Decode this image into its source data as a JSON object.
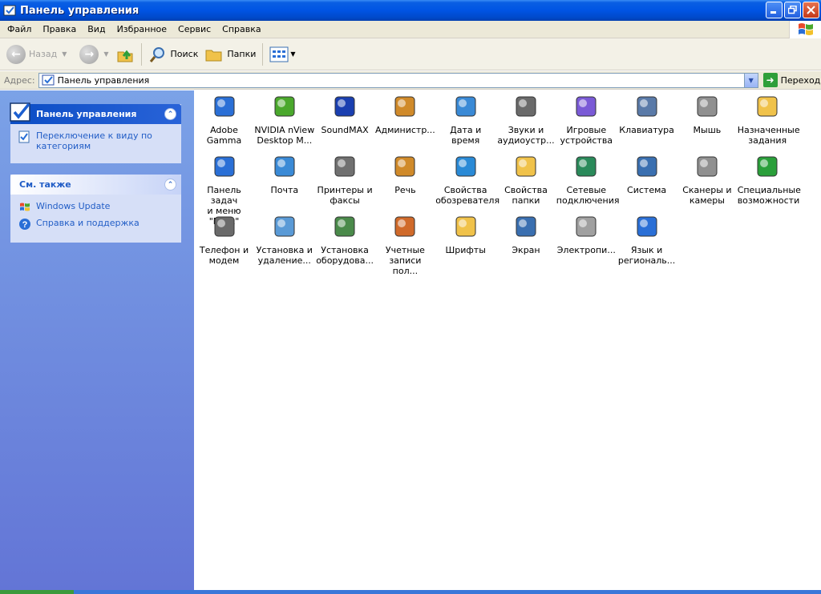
{
  "window": {
    "title": "Панель управления"
  },
  "menu": [
    "Файл",
    "Правка",
    "Вид",
    "Избранное",
    "Сервис",
    "Справка"
  ],
  "toolbar": {
    "back": "Назад",
    "search": "Поиск",
    "folders": "Папки"
  },
  "address": {
    "label": "Адрес:",
    "value": "Панель управления",
    "go": "Переход"
  },
  "left": {
    "panel1": {
      "title": "Панель управления",
      "link": "Переключение к виду по категориям"
    },
    "panel2": {
      "title": "См. также",
      "links": [
        "Windows Update",
        "Справка и поддержка"
      ]
    }
  },
  "items": [
    {
      "l1": "Adobe Gamma",
      "l2": "",
      "icon": "monitor-gamma-icon"
    },
    {
      "l1": "NVIDIA nView",
      "l2": "Desktop M...",
      "icon": "nvidia-icon"
    },
    {
      "l1": "SoundMAX",
      "l2": "",
      "icon": "soundmax-icon"
    },
    {
      "l1": "Администр...",
      "l2": "",
      "icon": "admin-tools-icon"
    },
    {
      "l1": "Дата и время",
      "l2": "",
      "icon": "date-time-icon"
    },
    {
      "l1": "Звуки и",
      "l2": "аудиоустр...",
      "icon": "speaker-icon"
    },
    {
      "l1": "Игровые",
      "l2": "устройства",
      "icon": "gamepad-icon"
    },
    {
      "l1": "Клавиатура",
      "l2": "",
      "icon": "keyboard-icon"
    },
    {
      "l1": "Мышь",
      "l2": "",
      "icon": "mouse-icon"
    },
    {
      "l1": "Назначенные",
      "l2": "задания",
      "icon": "scheduled-tasks-icon"
    },
    {
      "l1": "Панель задач",
      "l2": "и меню \"Пуск\"",
      "icon": "taskbar-icon"
    },
    {
      "l1": "Почта",
      "l2": "",
      "icon": "mail-icon"
    },
    {
      "l1": "Принтеры и",
      "l2": "факсы",
      "icon": "printer-icon"
    },
    {
      "l1": "Речь",
      "l2": "",
      "icon": "speech-icon"
    },
    {
      "l1": "Свойства",
      "l2": "обозревателя",
      "icon": "internet-options-icon"
    },
    {
      "l1": "Свойства",
      "l2": "папки",
      "icon": "folder-options-icon"
    },
    {
      "l1": "Сетевые",
      "l2": "подключения",
      "icon": "network-icon"
    },
    {
      "l1": "Система",
      "l2": "",
      "icon": "system-icon"
    },
    {
      "l1": "Сканеры и",
      "l2": "камеры",
      "icon": "scanner-camera-icon"
    },
    {
      "l1": "Специальные",
      "l2": "возможности",
      "icon": "accessibility-icon"
    },
    {
      "l1": "Телефон и",
      "l2": "модем",
      "icon": "phone-modem-icon"
    },
    {
      "l1": "Установка и",
      "l2": "удаление...",
      "icon": "add-remove-icon"
    },
    {
      "l1": "Установка",
      "l2": "оборудова...",
      "icon": "add-hardware-icon"
    },
    {
      "l1": "Учетные",
      "l2": "записи пол...",
      "icon": "user-accounts-icon"
    },
    {
      "l1": "Шрифты",
      "l2": "",
      "icon": "fonts-icon"
    },
    {
      "l1": "Экран",
      "l2": "",
      "icon": "display-icon"
    },
    {
      "l1": "Электропи...",
      "l2": "",
      "icon": "power-options-icon"
    },
    {
      "l1": "Язык и",
      "l2": "региональ...",
      "icon": "regional-icon"
    }
  ]
}
